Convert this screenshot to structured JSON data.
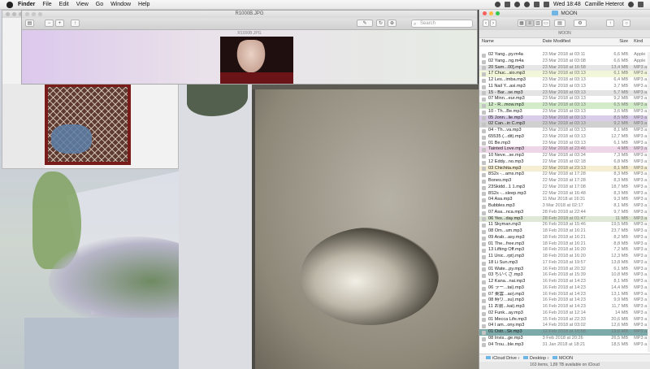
{
  "menubar": {
    "app": "Finder",
    "items": [
      "File",
      "Edit",
      "View",
      "Go",
      "Window",
      "Help"
    ],
    "clock": "Wed 18:48",
    "user": "Camille Heterot"
  },
  "preview": {
    "title": "R1000B.JPG",
    "subtitle": "R1000B.JPG",
    "search_placeholder": "Search"
  },
  "finder": {
    "title": "MOON",
    "path_label": "MOON",
    "columns": {
      "name": "Name",
      "date": "Date Modified",
      "size": "Size",
      "kind": "Kind"
    },
    "rows": [
      {
        "name": "02 Yang...py.m4a",
        "date": "23 Mar 2018 at 03:11",
        "size": "6,6 MB",
        "kind": "Apple",
        "color": ""
      },
      {
        "name": "02 Yang...ng.m4a",
        "date": "23 Mar 2018 at 03:08",
        "size": "6,6 MB",
        "kind": "Apple",
        "color": ""
      },
      {
        "name": "20 Sam...00].mp3",
        "date": "23 Mar 2018 at 16:58",
        "size": "13,4 MB",
        "kind": "MP3 a",
        "color": "#e6e6e6"
      },
      {
        "name": "17 Chuc...sio.mp3",
        "date": "23 Mar 2018 at 03:13",
        "size": "6,1 MB",
        "kind": "MP3 a",
        "color": "#f3f7d9"
      },
      {
        "name": "12 Les...imba.mp3",
        "date": "23 Mar 2018 at 03:13",
        "size": "6,4 MB",
        "kind": "MP3 a",
        "color": ""
      },
      {
        "name": "11 Nail Y...asi.mp3",
        "date": "23 Mar 2018 at 03:13",
        "size": "3,7 MB",
        "kind": "MP3 a",
        "color": ""
      },
      {
        "name": "15 - Bar...se.mp3",
        "date": "23 Mar 2018 at 03:13",
        "size": "5,7 MB",
        "kind": "MP3 a",
        "color": "#e4e4e4"
      },
      {
        "name": "07 Minn...eur.mp3",
        "date": "23 Mar 2018 at 03:13",
        "size": "9,2 MB",
        "kind": "MP3 a",
        "color": ""
      },
      {
        "name": "12 - R...mow.mp3",
        "date": "23 Mar 2018 at 03:13",
        "size": "6,5 MB",
        "kind": "MP3 a",
        "color": "#d2ecc9"
      },
      {
        "name": "10 - Th...Be.mp3",
        "date": "23 Mar 2018 at 03:13",
        "size": "3,6 MB",
        "kind": "MP3 a",
        "color": ""
      },
      {
        "name": "05 Jonn...lie.mp3",
        "date": "23 Mar 2018 at 03:13",
        "size": "8,5 MB",
        "kind": "MP3 a",
        "color": "#d9cdea"
      },
      {
        "name": "02 Can...in C.mp3",
        "date": "23 Mar 2018 at 03:13",
        "size": "9,2 MB",
        "kind": "MP3 a",
        "color": "#d0d0d0"
      },
      {
        "name": "04 - Th...va.mp3",
        "date": "23 Mar 2018 at 03:13",
        "size": "8,1 MB",
        "kind": "MP3 a",
        "color": ""
      },
      {
        "name": "65535 (...dit).mp3",
        "date": "23 Mar 2018 at 03:13",
        "size": "12,7 MB",
        "kind": "MP3 a",
        "color": ""
      },
      {
        "name": "01 Be.mp3",
        "date": "23 Mar 2018 at 03:13",
        "size": "6,1 MB",
        "kind": "MP3 a",
        "color": ""
      },
      {
        "name": "Tainted Love.mp3",
        "date": "22 Mar 2018 at 23:46",
        "size": "4 MB",
        "kind": "MP3 a",
        "color": "#ecd6e8"
      },
      {
        "name": "10 Neve...se.mp3",
        "date": "22 Mar 2018 at 03:34",
        "size": "7,3 MB",
        "kind": "MP3 a",
        "color": ""
      },
      {
        "name": "12 Eddy...no.mp3",
        "date": "22 Mar 2018 at 02:18",
        "size": "6,8 MB",
        "kind": "MP3 a",
        "color": ""
      },
      {
        "name": "03 Chichita.mp3",
        "date": "22 Mar 2018 at 23:13",
        "size": "8,1 MB",
        "kind": "MP3 a",
        "color": "#f5eed2"
      },
      {
        "name": "8S2s -...ams.mp3",
        "date": "22 Mar 2018 at 17:28",
        "size": "8,3 MB",
        "kind": "MP3 a",
        "color": ""
      },
      {
        "name": "Bones.mp3",
        "date": "22 Mar 2018 at 17:28",
        "size": "8,3 MB",
        "kind": "MP3 a",
        "color": ""
      },
      {
        "name": "23Skidd...1 1.mp3",
        "date": "22 Mar 2018 at 17:08",
        "size": "18,7 MB",
        "kind": "MP3 a",
        "color": ""
      },
      {
        "name": "8S2s -...sleep.mp3",
        "date": "22 Mar 2018 at 16:48",
        "size": "8,3 MB",
        "kind": "MP3 a",
        "color": ""
      },
      {
        "name": "04 Asa.mp3",
        "date": "11 Mar 2018 at 16:31",
        "size": "9,3 MB",
        "kind": "MP3 a",
        "color": ""
      },
      {
        "name": "Bubbles.mp3",
        "date": "3 Mar 2018 at 02:17",
        "size": "8,1 MB",
        "kind": "MP3 a",
        "color": ""
      },
      {
        "name": "07 Asa...nca.mp3",
        "date": "28 Feb 2018 at 22:44",
        "size": "9,7 MB",
        "kind": "MP3 a",
        "color": ""
      },
      {
        "name": "06 Yes...day.mp3",
        "date": "28 Feb 2018 at 01:47",
        "size": "11 MB",
        "kind": "MP3 a",
        "color": "#dfe8d7"
      },
      {
        "name": "11 Skyman.mp3",
        "date": "26 Feb 2018 at 15:46",
        "size": "19,5 MB",
        "kind": "MP3 a",
        "color": ""
      },
      {
        "name": "08 Om...um.mp3",
        "date": "18 Feb 2018 at 16:21",
        "size": "23,7 MB",
        "kind": "MP3 a",
        "color": ""
      },
      {
        "name": "09 Arab...asy.mp3",
        "date": "18 Feb 2018 at 16:21",
        "size": "8,2 MB",
        "kind": "MP3 a",
        "color": ""
      },
      {
        "name": "01 The...free.mp3",
        "date": "18 Feb 2018 at 16:21",
        "size": "8,8 MB",
        "kind": "MP3 a",
        "color": ""
      },
      {
        "name": "13 Lifting Off.mp3",
        "date": "18 Feb 2018 at 16:20",
        "size": "7,2 MB",
        "kind": "MP3 a",
        "color": ""
      },
      {
        "name": "11 Unic...rpt).mp3",
        "date": "18 Feb 2018 at 16:20",
        "size": "12,3 MB",
        "kind": "MP3 a",
        "color": ""
      },
      {
        "name": "18 Li Sun.mp3",
        "date": "17 Feb 2018 at 19:57",
        "size": "13,8 MB",
        "kind": "MP3 a",
        "color": ""
      },
      {
        "name": "01 Wate...py.mp3",
        "date": "16 Feb 2018 at 20:32",
        "size": "6,1 MB",
        "kind": "MP3 a",
        "color": ""
      },
      {
        "name": "03 ちいくさ.mp3",
        "date": "16 Feb 2018 at 15:39",
        "size": "10,8 MB",
        "kind": "MP3 a",
        "color": ""
      },
      {
        "name": "12 Kana...nai.mp3",
        "date": "16 Feb 2018 at 14:23",
        "size": "8,1 MB",
        "kind": "MP3 a",
        "color": ""
      },
      {
        "name": "06 ラー...tai).mp3",
        "date": "16 Feb 2018 at 14:23",
        "size": "14,4 MB",
        "kind": "MP3 a",
        "color": ""
      },
      {
        "name": "07 東雲...ao).mp3",
        "date": "16 Feb 2018 at 14:23",
        "size": "13,1 MB",
        "kind": "MP3 a",
        "color": ""
      },
      {
        "name": "08 時り...su).mp3",
        "date": "16 Feb 2018 at 14:23",
        "size": "9,9 MB",
        "kind": "MP3 a",
        "color": ""
      },
      {
        "name": "11 お前...kai).mp3",
        "date": "16 Feb 2018 at 14:23",
        "size": "11,7 MB",
        "kind": "MP3 a",
        "color": ""
      },
      {
        "name": "02 Funk...ay.mp3",
        "date": "16 Feb 2018 at 12:14",
        "size": "14 MB",
        "kind": "MP3 a",
        "color": ""
      },
      {
        "name": "01 Mecca Life.mp3",
        "date": "15 Feb 2018 at 22:33",
        "size": "20,6 MB",
        "kind": "MP3 a",
        "color": ""
      },
      {
        "name": "04 I am...ony.mp3",
        "date": "14 Feb 2018 at 03:02",
        "size": "12,6 MB",
        "kind": "MP3 a",
        "color": ""
      },
      {
        "name": "01 Ostr...Sk.mp3",
        "date": "12 Feb 2018 at 16:58",
        "size": "19,6 MB",
        "kind": "MP3 a",
        "color": "#7ca9a9"
      },
      {
        "name": "08 Invis...ge.mp3",
        "date": "3 Feb 2018 at 20:26",
        "size": "26,5 MB",
        "kind": "MP3 a",
        "color": ""
      },
      {
        "name": "04 Trou...ble.mp3",
        "date": "31 Jan 2018 at 18:21",
        "size": "18,5 MB",
        "kind": "MP3 a",
        "color": ""
      }
    ],
    "pathbar": {
      "items": [
        "iCloud Drive",
        "Desktop",
        "MOON"
      ]
    },
    "status": "163 items, 1,89 TB available on iCloud"
  }
}
